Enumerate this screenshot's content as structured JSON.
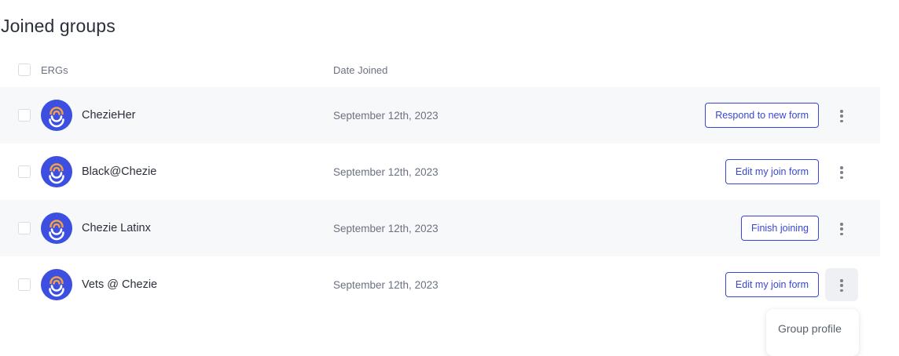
{
  "page_title": "Joined groups",
  "table": {
    "headers": {
      "ergs": "ERGs",
      "date_joined": "Date Joined"
    },
    "rows": [
      {
        "name": "ChezieHer",
        "date": "September 12th, 2023",
        "action": "Respond to new form"
      },
      {
        "name": "Black@Chezie",
        "date": "September 12th, 2023",
        "action": "Edit my join form"
      },
      {
        "name": "Chezie Latinx",
        "date": "September 12th, 2023",
        "action": "Finish joining"
      },
      {
        "name": "Vets @ Chezie",
        "date": "September 12th, 2023",
        "action": "Edit my join form"
      }
    ]
  },
  "menu": {
    "items": [
      "Group profile"
    ]
  },
  "colors": {
    "accent": "#3a47d5",
    "avatar_bg": "#3c4fe0",
    "avatar_arc": "#f0a04a",
    "row_shade": "#f7f8fa"
  },
  "icons": {
    "avatar": "chezie-logo-icon",
    "more": "more-vertical-icon"
  }
}
